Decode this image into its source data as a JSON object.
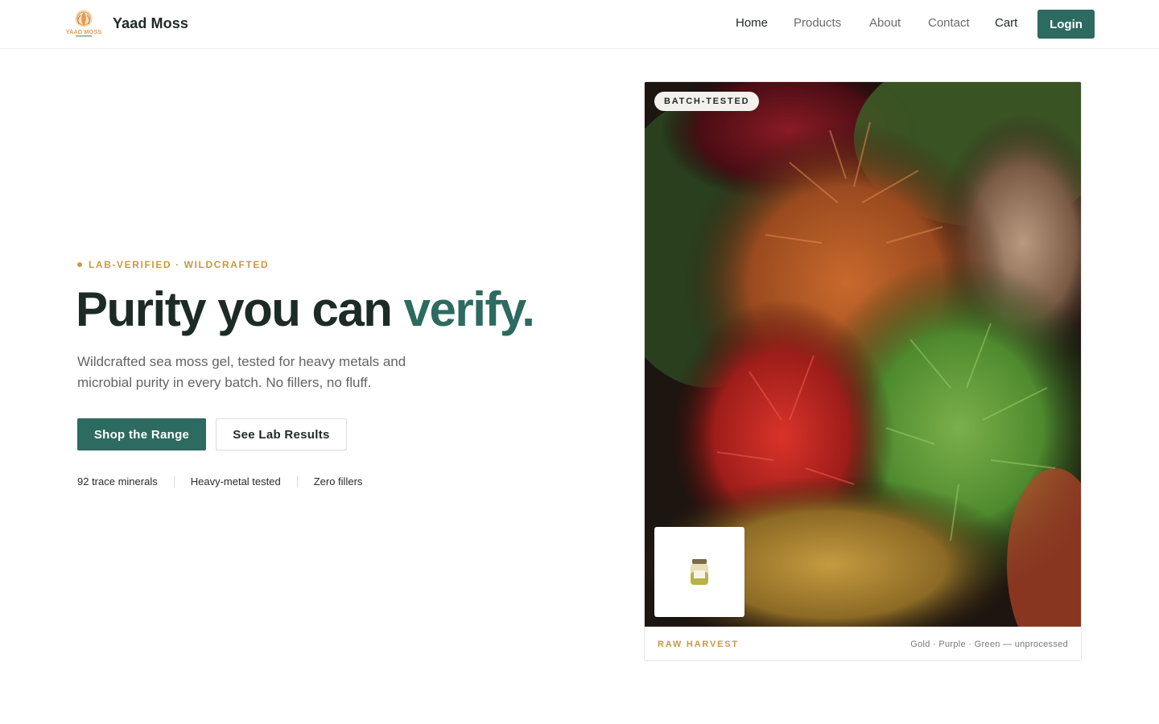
{
  "header": {
    "brand": "Yaad Moss",
    "logo_text": "YAAD MOSS",
    "nav": [
      {
        "label": "Home",
        "active": true
      },
      {
        "label": "Products"
      },
      {
        "label": "About"
      },
      {
        "label": "Contact"
      },
      {
        "label": "Cart"
      }
    ],
    "login_label": "Login"
  },
  "hero": {
    "eyebrow": "LAB-VERIFIED · WILDCRAFTED",
    "headline_main": "Purity you can ",
    "headline_accent": "verify.",
    "subtext": "Wildcrafted sea moss gel, tested for heavy metals and microbial purity in every batch. No fillers, no fluff.",
    "primary_cta": "Shop the Range",
    "secondary_cta": "See Lab Results",
    "features": [
      "92 trace minerals",
      "Heavy-metal tested",
      "Zero fillers"
    ]
  },
  "card": {
    "badge": "BATCH-TESTED",
    "footer_label": "RAW HARVEST",
    "footer_note": "Gold · Purple · Green — unprocessed",
    "image_icon": "sea-moss-photo",
    "thumb_icon": "jar-icon"
  },
  "colors": {
    "brand_green": "#2d6a5f",
    "gold": "#c49a45",
    "ink": "#1d2b27"
  }
}
